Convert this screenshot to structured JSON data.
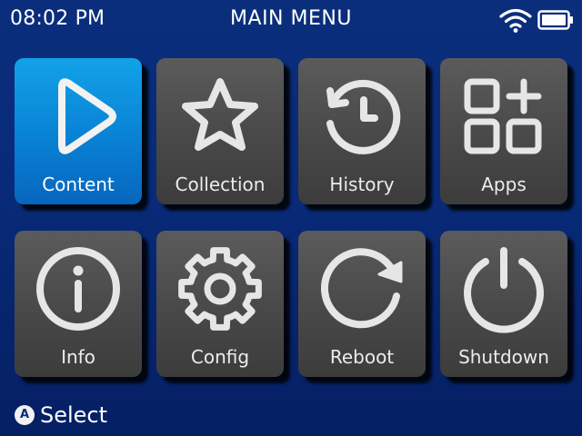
{
  "status_bar": {
    "time": "08:02 PM",
    "title": "MAIN MENU",
    "wifi_icon": "wifi-icon",
    "battery_icon": "battery-full-icon"
  },
  "colors": {
    "background": "#082a78",
    "tile": "#4a4a4a",
    "tile_selected": "#0a84d6",
    "icon": "#ececec"
  },
  "menu": {
    "selected": "Content",
    "items": [
      {
        "label": "Content",
        "icon": "play-icon"
      },
      {
        "label": "Collection",
        "icon": "star-icon"
      },
      {
        "label": "History",
        "icon": "history-icon"
      },
      {
        "label": "Apps",
        "icon": "apps-icon"
      },
      {
        "label": "Info",
        "icon": "info-icon"
      },
      {
        "label": "Config",
        "icon": "gear-icon"
      },
      {
        "label": "Reboot",
        "icon": "reboot-icon"
      },
      {
        "label": "Shutdown",
        "icon": "power-icon"
      }
    ]
  },
  "footer": {
    "button_glyph": "A",
    "hint": "Select"
  }
}
